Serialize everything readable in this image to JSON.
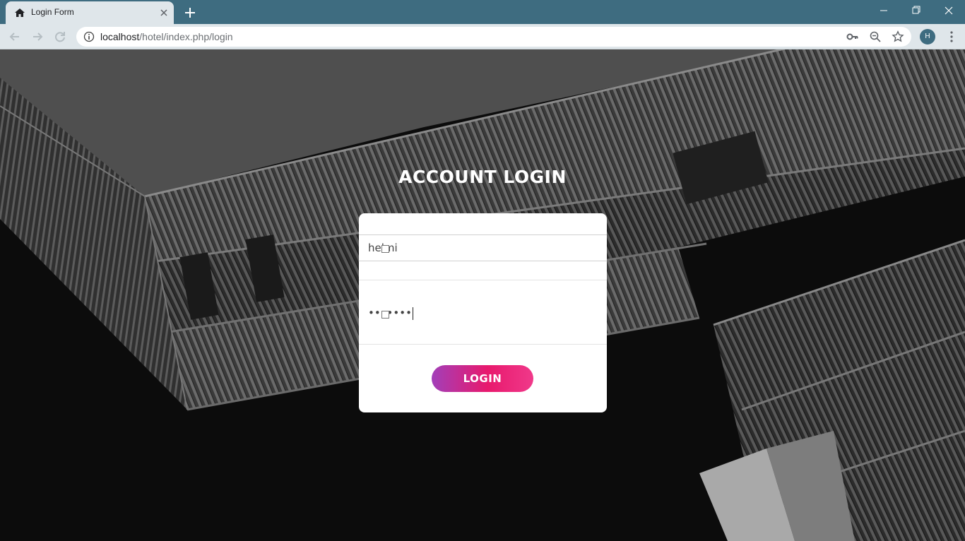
{
  "browser": {
    "tab_title": "Login Form",
    "url_host": "localhost",
    "url_path": "/hotel/index.php/login",
    "profile_initial": "H"
  },
  "page": {
    "heading": "ACCOUNT LOGIN",
    "username_value": "helmi",
    "password_value": "•••••••",
    "login_label": "LOGIN"
  },
  "colors": {
    "titlebar": "#3e6c80",
    "toolbar": "#dfe6ea",
    "button_gradient_start": "#a23fb9",
    "button_gradient_end": "#f0398a"
  }
}
